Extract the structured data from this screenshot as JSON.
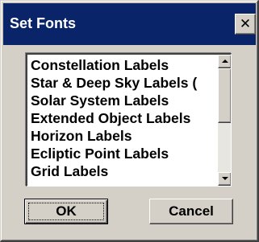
{
  "dialog": {
    "title": "Set Fonts",
    "close_glyph": "✕",
    "close_icon": "close-icon"
  },
  "font_list": {
    "items": [
      "Constellation Labels",
      "Star & Deep Sky Labels (",
      "Solar System Labels",
      "Extended Object Labels",
      "Horizon Labels",
      "Ecliptic Point Labels",
      "Grid Labels"
    ],
    "scroll_position": 0
  },
  "buttons": {
    "ok_label": "OK",
    "cancel_label": "Cancel"
  },
  "colors": {
    "face": "#d4d0c8",
    "titlebar": "#0a246a",
    "title_text": "#ffffff",
    "list_background": "#ffffff"
  }
}
